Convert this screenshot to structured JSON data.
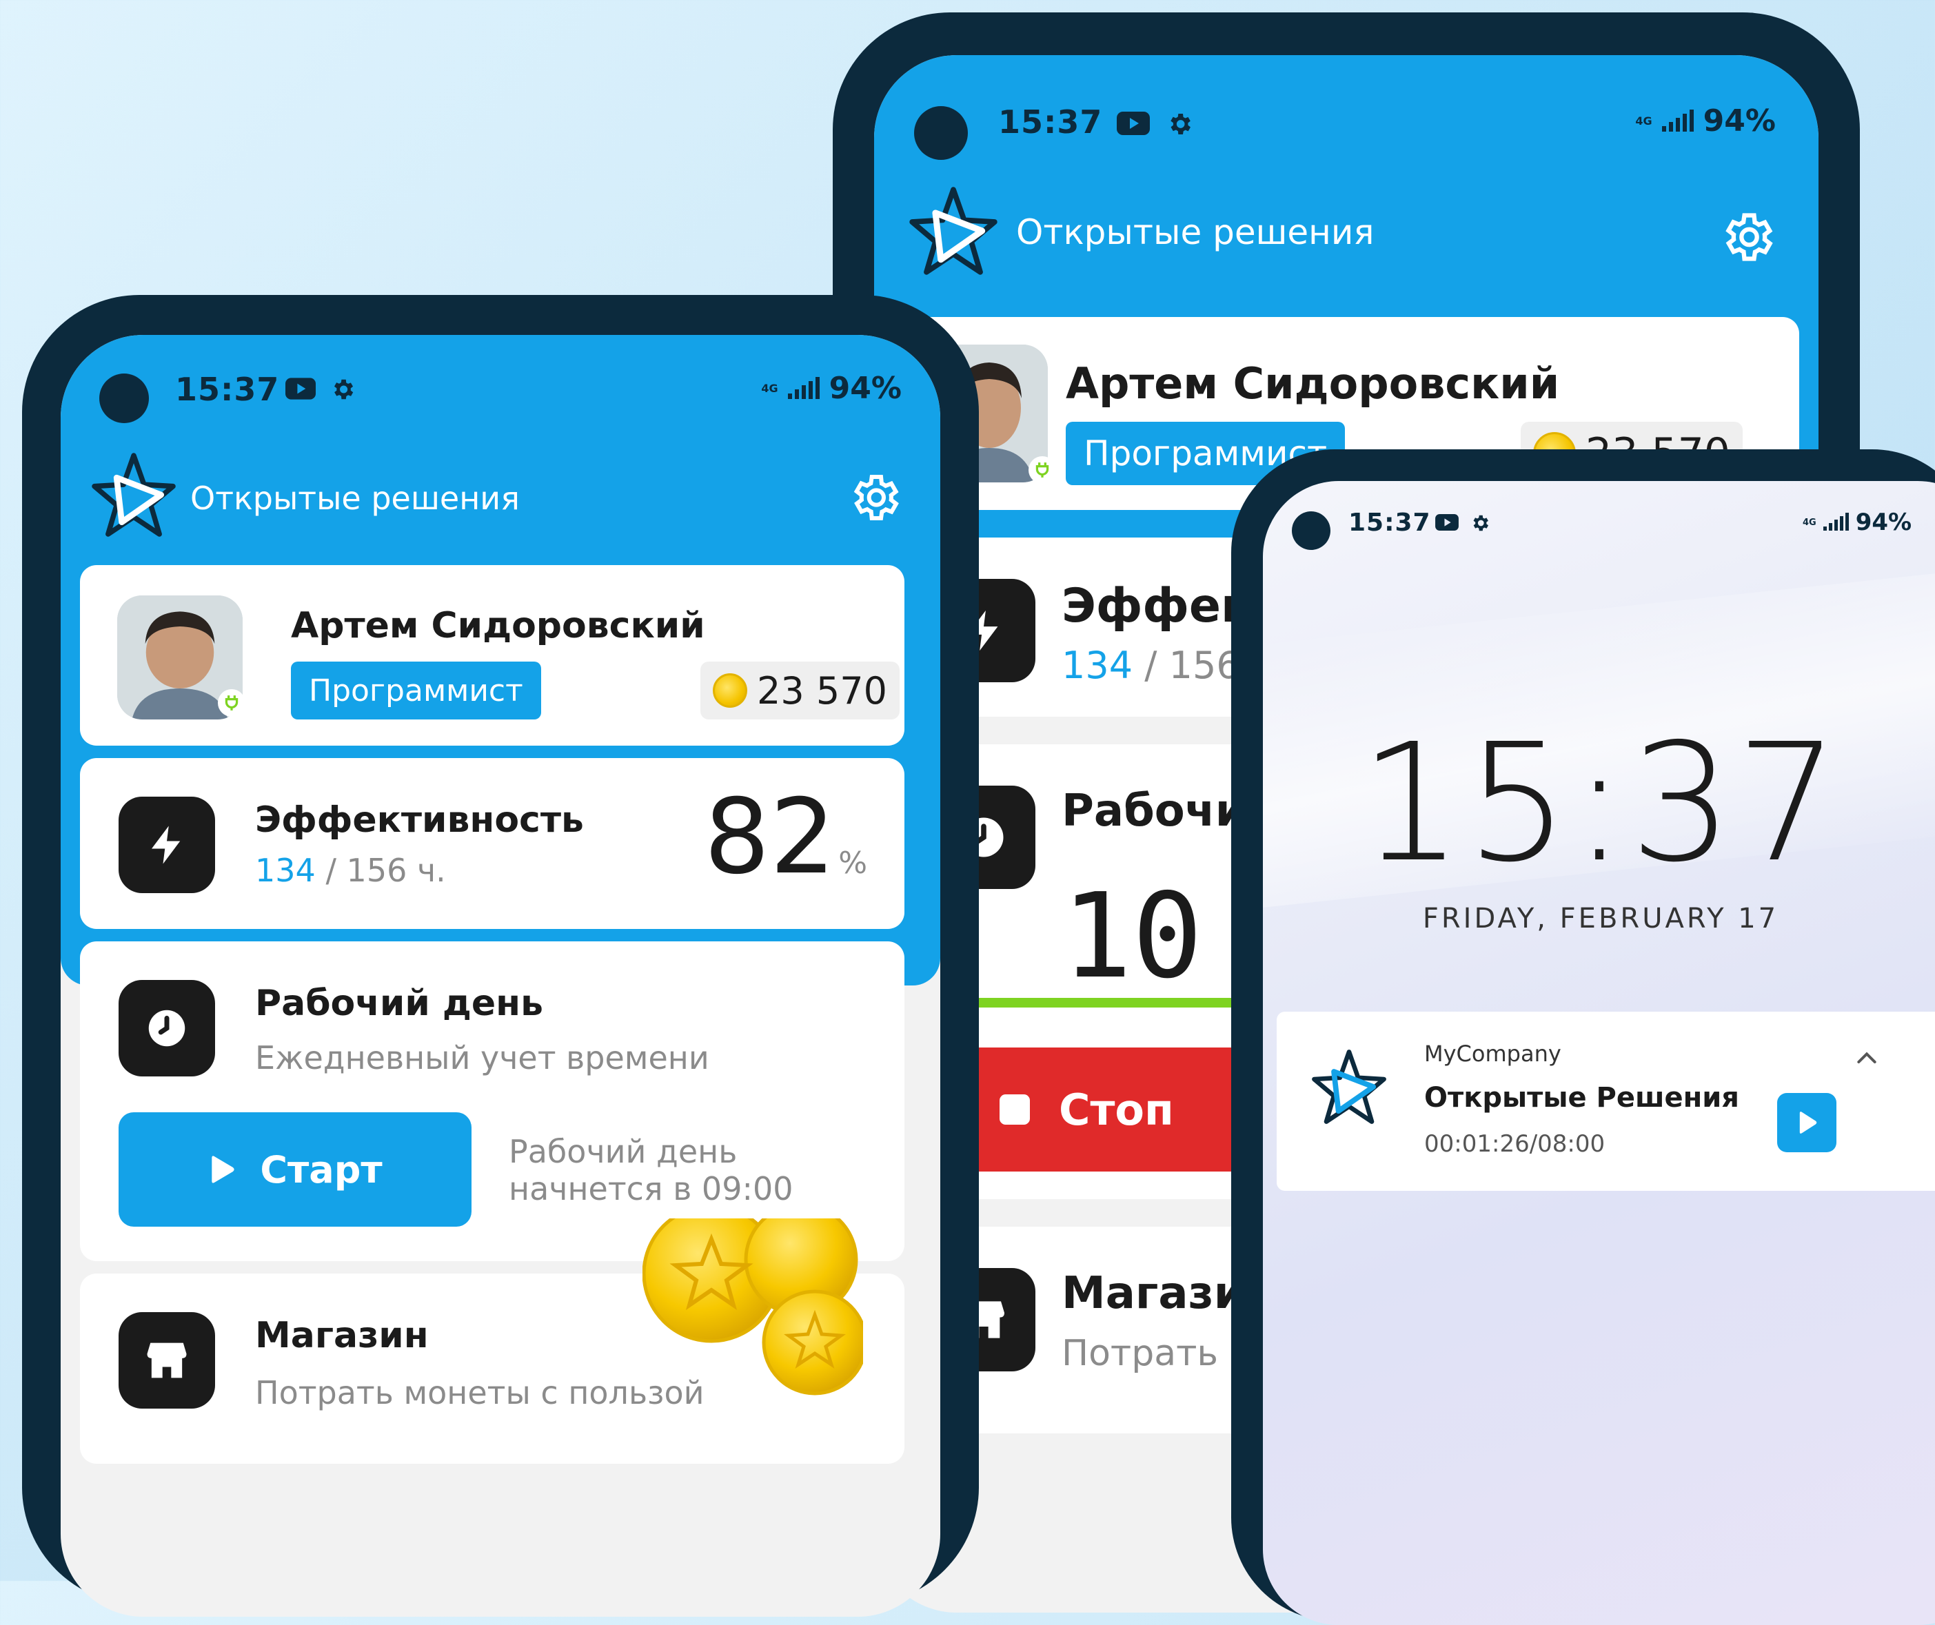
{
  "phone_back": {
    "status": {
      "time": "15:37",
      "network": "4G",
      "battery": "94%"
    },
    "app_title": "Открытые решения",
    "profile": {
      "name": "Артем Сидоровский",
      "role": "Программист",
      "coins": "23 570"
    },
    "efficiency": {
      "title": "Эффек",
      "hours_done": "134",
      "hours_total": "/ 156"
    },
    "workday": {
      "title": "Рабочи",
      "timer": "10"
    },
    "stop_label": "Стоп",
    "shop": {
      "title": "Магази",
      "subtitle": "Потрать"
    }
  },
  "phone_front": {
    "status": {
      "time": "15:37",
      "network": "4G",
      "battery": "94%"
    },
    "app_title": "Открытые решения",
    "profile": {
      "name": "Артем Сидоровский",
      "role": "Программист",
      "coins": "23 570"
    },
    "efficiency": {
      "title": "Эффективность",
      "hours_done": "134",
      "hours_total": "/ 156 ч.",
      "percent": "82",
      "percent_sign": "%"
    },
    "workday": {
      "title": "Рабочий день",
      "subtitle": "Ежедневный учет времени",
      "start_label": "Старт",
      "note_line1": "Рабочий день",
      "note_line2": "начнется в 09:00"
    },
    "shop": {
      "title": "Магазин",
      "subtitle": "Потрать монеты с пользой"
    }
  },
  "phone_lock": {
    "status": {
      "time": "15:37",
      "network": "4G",
      "battery": "94%"
    },
    "clock": "15:37",
    "date": "FRIDAY, FEBRUARY 17",
    "notification": {
      "app": "MyCompany",
      "title": "Открытые Решения",
      "timer": "00:01:26/08:00"
    }
  },
  "colors": {
    "brand_blue": "#14a2e8",
    "dark_navy": "#0c2a3d",
    "stop_red": "#e02a2a",
    "progress_green": "#7ed321"
  },
  "icons": [
    "star-logo-icon",
    "gear-icon",
    "lightning-icon",
    "clock-icon",
    "play-icon",
    "stop-icon",
    "shop-icon",
    "coin-icon",
    "youtube-icon",
    "chevron-up-icon",
    "plug-icon"
  ]
}
